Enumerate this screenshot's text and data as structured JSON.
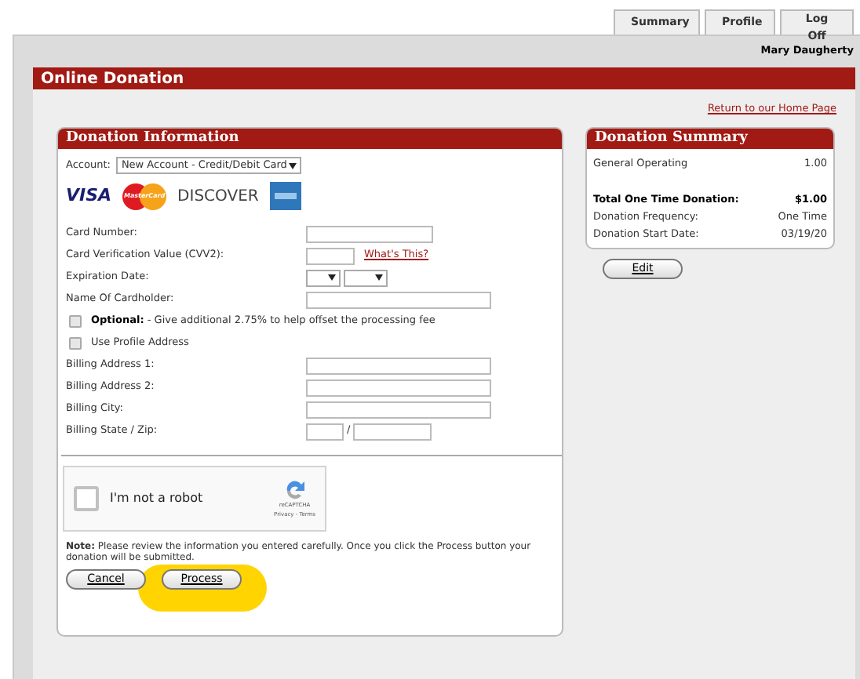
{
  "tabs": [
    {
      "label": "Summary",
      "selected": false
    },
    {
      "label": "Profile",
      "selected": false
    },
    {
      "label": "Log Off",
      "selected": false
    }
  ],
  "user_name": "Mary Daugherty",
  "page_title": "Online Donation",
  "home_link": "Return to our Home Page",
  "donation_info": {
    "title": "Donation Information",
    "account_label": "Account:",
    "account_value": "New Account - Credit/Debit Card",
    "card_brands": [
      "VISA",
      "MasterCard",
      "DISCOVER"
    ],
    "fields": [
      {
        "kind": "text",
        "label": "Card Number:"
      },
      {
        "kind": "cvv",
        "label": "Card Verification Value (CVV2):",
        "link": "What's This?"
      },
      {
        "kind": "date",
        "label": "Expiration Date:"
      },
      {
        "kind": "wide",
        "label": "Name Of Cardholder:"
      }
    ],
    "options": [
      {
        "bold": "Optional:",
        "text": " - Give additional 2.75% to help offset the processing fee",
        "checked": false
      },
      {
        "text": "Use Profile Address",
        "checked": false
      }
    ],
    "billing": [
      {
        "kind": "wide",
        "label": "Billing Address 1:"
      },
      {
        "kind": "wide",
        "label": "Billing Address 2:"
      },
      {
        "kind": "wide",
        "label": "Billing City:"
      },
      {
        "kind": "zip",
        "label": "Billing State / Zip:",
        "separator": "/"
      }
    ],
    "captcha": {
      "label": "I'm not a robot",
      "brand": "reCAPTCHA",
      "links": "Privacy - Terms",
      "checked": false
    },
    "note": "**Note:** Please review the information you entered carefully. Once you click the Process button your donation will be submitted.",
    "buttons": [
      "Cancel",
      "Process"
    ]
  },
  "summary": {
    "title": "Donation Summary",
    "rows": [
      {
        "kind": "item",
        "label": "General Operating",
        "value": "1.00"
      },
      {
        "kind": "total",
        "label": "Total One Time Donation:",
        "value": "$1.00"
      },
      {
        "kind": "info",
        "label": "Donation Frequency:",
        "value": "One Time"
      },
      {
        "kind": "info",
        "label": "Donation Start Date:",
        "value": "03/19/20"
      }
    ],
    "edit_button": "Edit"
  }
}
